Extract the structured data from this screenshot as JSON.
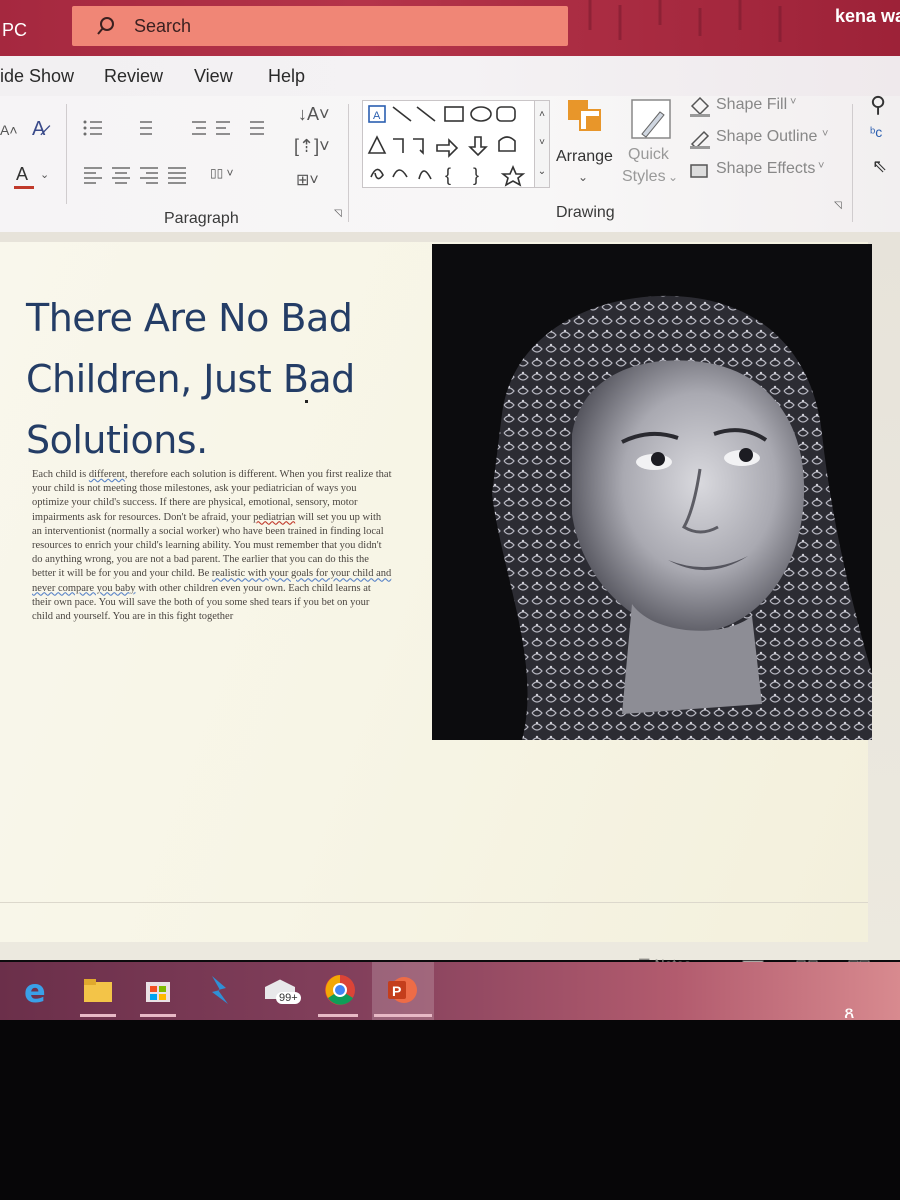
{
  "titlebar": {
    "app_suffix": "PC",
    "search_placeholder": "Search",
    "user_name": "kena wal"
  },
  "tabs": [
    {
      "label": "ide Show"
    },
    {
      "label": "Review"
    },
    {
      "label": "View"
    },
    {
      "label": "Help"
    }
  ],
  "ribbon": {
    "paragraph_group_label": "Paragraph",
    "drawing_group_label": "Drawing",
    "arrange_label": "Arrange",
    "quick_styles_label_1": "Quick",
    "quick_styles_label_2": "Styles",
    "shape_fill_label": "Shape Fill",
    "shape_outline_label": "Shape Outline",
    "shape_effects_label": "Shape Effects"
  },
  "slide": {
    "title_line1": "There Are No Bad",
    "title_line2": "Children, Just Bad",
    "title_line3": "Solutions.",
    "body_part1": "Each child is ",
    "body_word_different": "different",
    "body_part2": ", therefore each solution is different. When you first realize that your child is not meeting those milestones, ask your pediatrician of ways you optimize your child's success. If there are physical, emotional, sensory, motor impairments ask for resources. Don't be afraid, your ",
    "body_word_pediatrian": "pediatrian",
    "body_part3": " will set you up with an interventionist (normally a social worker) who have been trained in finding local resources to enrich your child's learning ability. You must remember that you didn't do anything wrong, you are not a bad parent. The earlier that you can do this the better it will be for you and your child. Be ",
    "body_realistic": "realistic with your goals for your child and never compare you baby",
    "body_part4": " with other children even your own. Each child learns at their own pace. You will save the both of you some shed tears if you bet on your child and yourself. You are in this fight together",
    "photo_subject": "black-and-white portrait of a girl wearing a patterned headscarf"
  },
  "statusbar": {
    "notes_label": "Notes"
  },
  "taskbar": {
    "mail_badge": "99+"
  },
  "colors": {
    "titlebar": "#a5283f",
    "search_box": "#f08676",
    "slide_title": "#243d66",
    "accent_orange": "#e8962a"
  }
}
